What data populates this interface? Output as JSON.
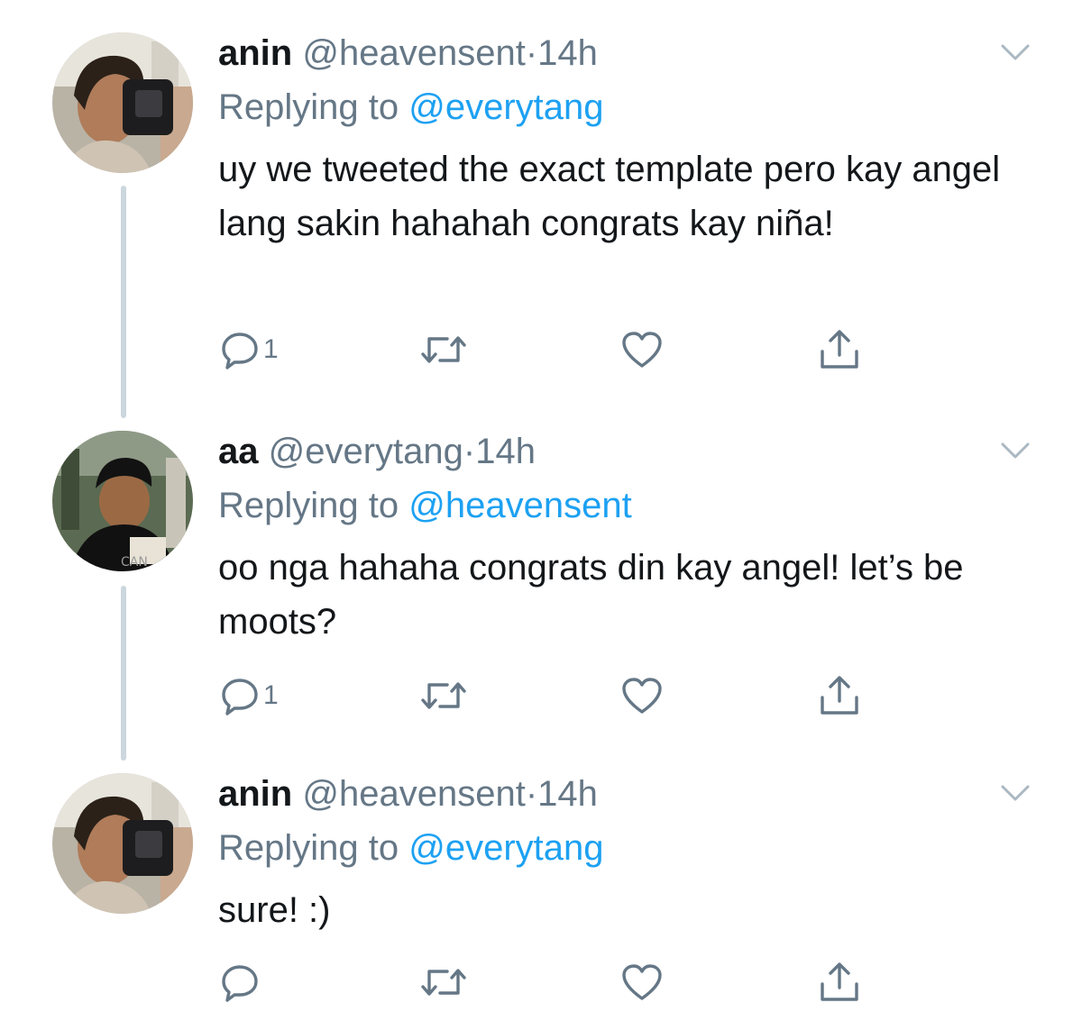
{
  "colors": {
    "accent": "#1da1f2",
    "muted": "#657786",
    "text": "#14171a",
    "thread_line": "#ccd6dd"
  },
  "tweets": [
    {
      "name": "anin",
      "handle": "@heavensent",
      "separator": "·",
      "time": "14h",
      "replying_prefix": "Replying to",
      "replying_to": "@everytang",
      "text": "uy we tweeted the exact template pero kay angel lang sakin hahahah congrats kay niña!",
      "reply_count": "1",
      "icons": [
        "reply-icon",
        "retweet-icon",
        "like-icon",
        "share-icon",
        "chevron-down-icon"
      ]
    },
    {
      "name": "aa",
      "handle": "@everytang",
      "separator": "·",
      "time": "14h",
      "replying_prefix": "Replying to",
      "replying_to": "@heavensent",
      "text": "oo nga hahaha congrats din kay angel! let’s be moots?",
      "reply_count": "1",
      "avatar_shirt_text": "CAN",
      "icons": [
        "reply-icon",
        "retweet-icon",
        "like-icon",
        "share-icon",
        "chevron-down-icon"
      ]
    },
    {
      "name": "anin",
      "handle": "@heavensent",
      "separator": "·",
      "time": "14h",
      "replying_prefix": "Replying to",
      "replying_to": "@everytang",
      "text": "sure! :)",
      "reply_count": "",
      "icons": [
        "reply-icon",
        "retweet-icon",
        "like-icon",
        "share-icon",
        "chevron-down-icon"
      ]
    }
  ]
}
